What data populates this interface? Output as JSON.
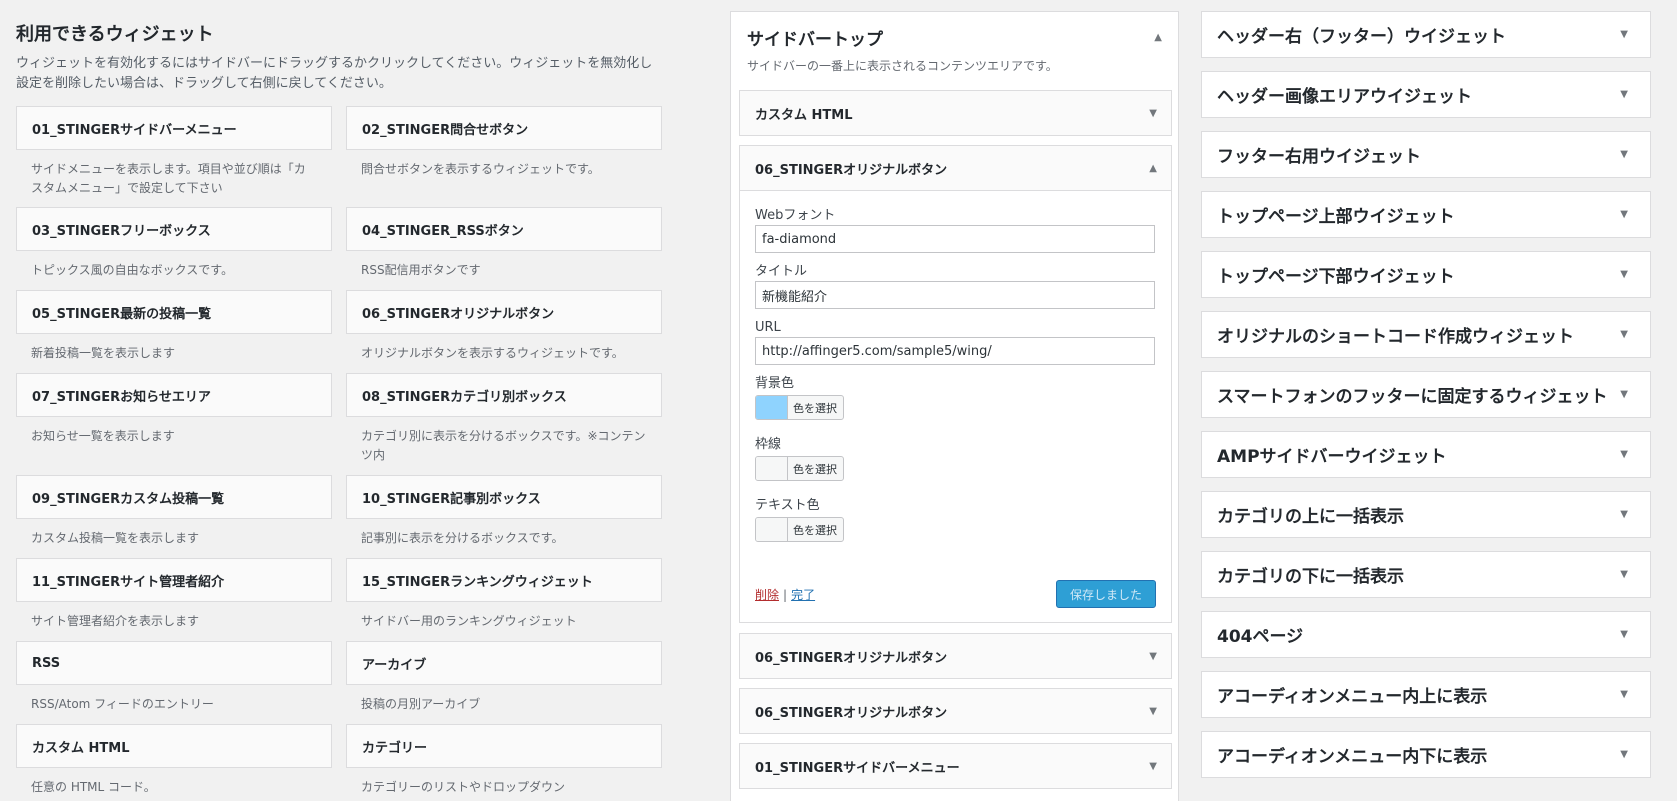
{
  "available": {
    "title": "利用できるウィジェット",
    "desc_line1": "ウィジェットを有効化するにはサイドバーにドラッグするかクリックしてください。ウィジェットを無効化し",
    "desc_line2": "設定を削除したい場合は、ドラッグして右側に戻してください。",
    "widgets": [
      {
        "name": "01_STINGERサイドバーメニュー",
        "desc": "サイドメニューを表示します。項目や並び順は「カスタムメニュー」で設定して下さい"
      },
      {
        "name": "02_STINGER問合せボタン",
        "desc": "問合せボタンを表示するウィジェットです。"
      },
      {
        "name": "03_STINGERフリーボックス",
        "desc": "トピックス風の自由なボックスです。"
      },
      {
        "name": "04_STINGER_RSSボタン",
        "desc": "RSS配信用ボタンです"
      },
      {
        "name": "05_STINGER最新の投稿一覧",
        "desc": "新着投稿一覧を表示します"
      },
      {
        "name": "06_STINGERオリジナルボタン",
        "desc": "オリジナルボタンを表示するウィジェットです。"
      },
      {
        "name": "07_STINGERお知らせエリア",
        "desc": "お知らせ一覧を表示します"
      },
      {
        "name": "08_STINGERカテゴリ別ボックス",
        "desc": "カテゴリ別に表示を分けるボックスです。※コンテンツ内"
      },
      {
        "name": "09_STINGERカスタム投稿一覧",
        "desc": "カスタム投稿一覧を表示します"
      },
      {
        "name": "10_STINGER記事別ボックス",
        "desc": "記事別に表示を分けるボックスです。"
      },
      {
        "name": "11_STINGERサイト管理者紹介",
        "desc": "サイト管理者紹介を表示します"
      },
      {
        "name": "15_STINGERランキングウィジェット",
        "desc": "サイドバー用のランキングウィジェット"
      },
      {
        "name": "RSS",
        "desc": "RSS/Atom フィードのエントリー"
      },
      {
        "name": "アーカイブ",
        "desc": "投稿の月別アーカイブ"
      },
      {
        "name": "カスタム HTML",
        "desc": "任意の HTML コード。"
      },
      {
        "name": "カテゴリー",
        "desc": "カテゴリーのリストやドロップダウン"
      }
    ]
  },
  "sidebar_top": {
    "title": "サイドバートップ",
    "desc": "サイドバーの一番上に表示されるコンテンツエリアです。",
    "items": [
      {
        "label": "カスタム HTML"
      },
      {
        "label": "06_STINGERオリジナルボタン"
      },
      {
        "label": "06_STINGERオリジナルボタン"
      },
      {
        "label": "06_STINGERオリジナルボタン"
      },
      {
        "label": "01_STINGERサイドバーメニュー"
      }
    ],
    "form": {
      "webfont_label": "Webフォント",
      "webfont_value": "fa-diamond",
      "title_label": "タイトル",
      "title_value": "新機能紹介",
      "url_label": "URL",
      "url_value": "http://affinger5.com/sample5/wing/",
      "bg_label": "背景色",
      "bg_color": "#8fd3fe",
      "border_label": "枠線",
      "text_label": "テキスト色",
      "select_color": "色を選択",
      "delete": "削除",
      "separator": "|",
      "done": "完了",
      "saved": "保存しました"
    }
  },
  "right_sidebars": [
    "ヘッダー右（フッター）ウイジェット",
    "ヘッダー画像エリアウイジェット",
    "フッター右用ウイジェット",
    "トップページ上部ウイジェット",
    "トップページ下部ウイジェット",
    "オリジナルのショートコード作成ウィジェット",
    "スマートフォンのフッターに固定するウィジェット",
    "AMPサイドバーウイジェット",
    "カテゴリの上に一括表示",
    "カテゴリの下に一括表示",
    "404ページ",
    "アコーディオンメニュー内上に表示",
    "アコーディオンメニュー内下に表示"
  ],
  "icons": {
    "collapse": "▲",
    "expand": "▼"
  }
}
